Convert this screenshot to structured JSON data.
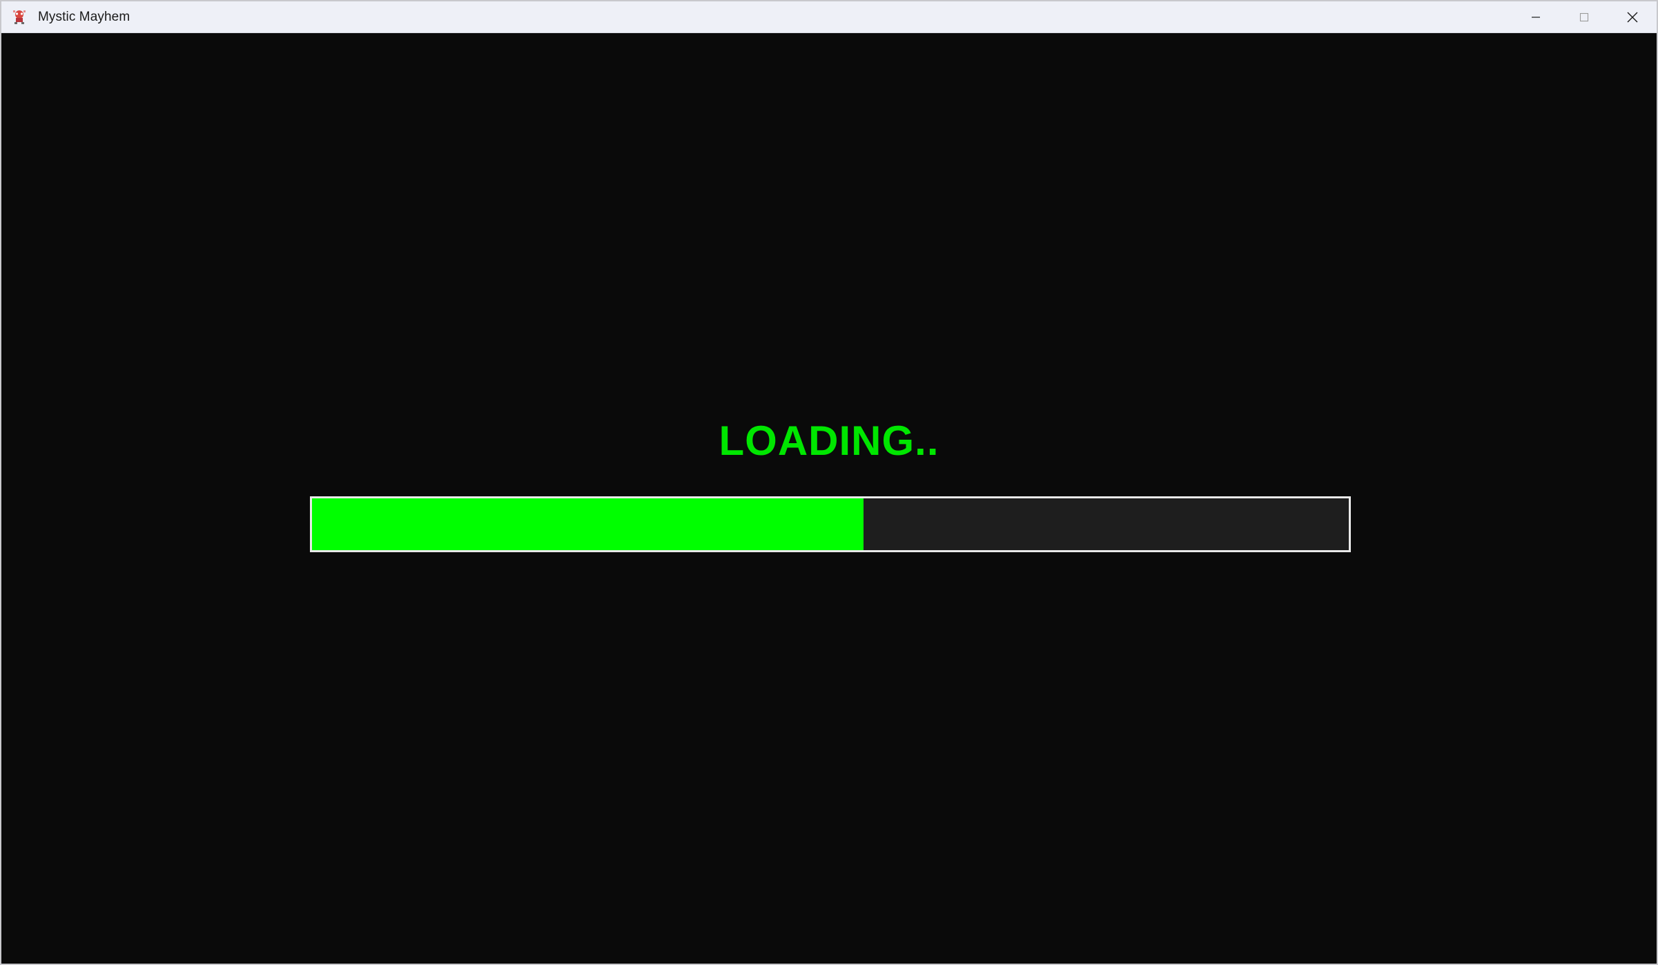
{
  "window": {
    "title": "Mystic Mayhem",
    "app_icon": "mystic-mayhem-app-icon",
    "controls": {
      "minimize_icon": "minimize-icon",
      "maximize_icon": "maximize-icon",
      "close_icon": "close-icon"
    }
  },
  "loading": {
    "text": "LOADING..",
    "progress_fraction": 0.532,
    "fill_color": "#00ff00",
    "text_color": "#00e600",
    "track_color": "#1e1e1e",
    "border_color": "#e9e9e9"
  },
  "colors": {
    "background": "#0a0a0a",
    "titlebar": "#eef0f7"
  }
}
